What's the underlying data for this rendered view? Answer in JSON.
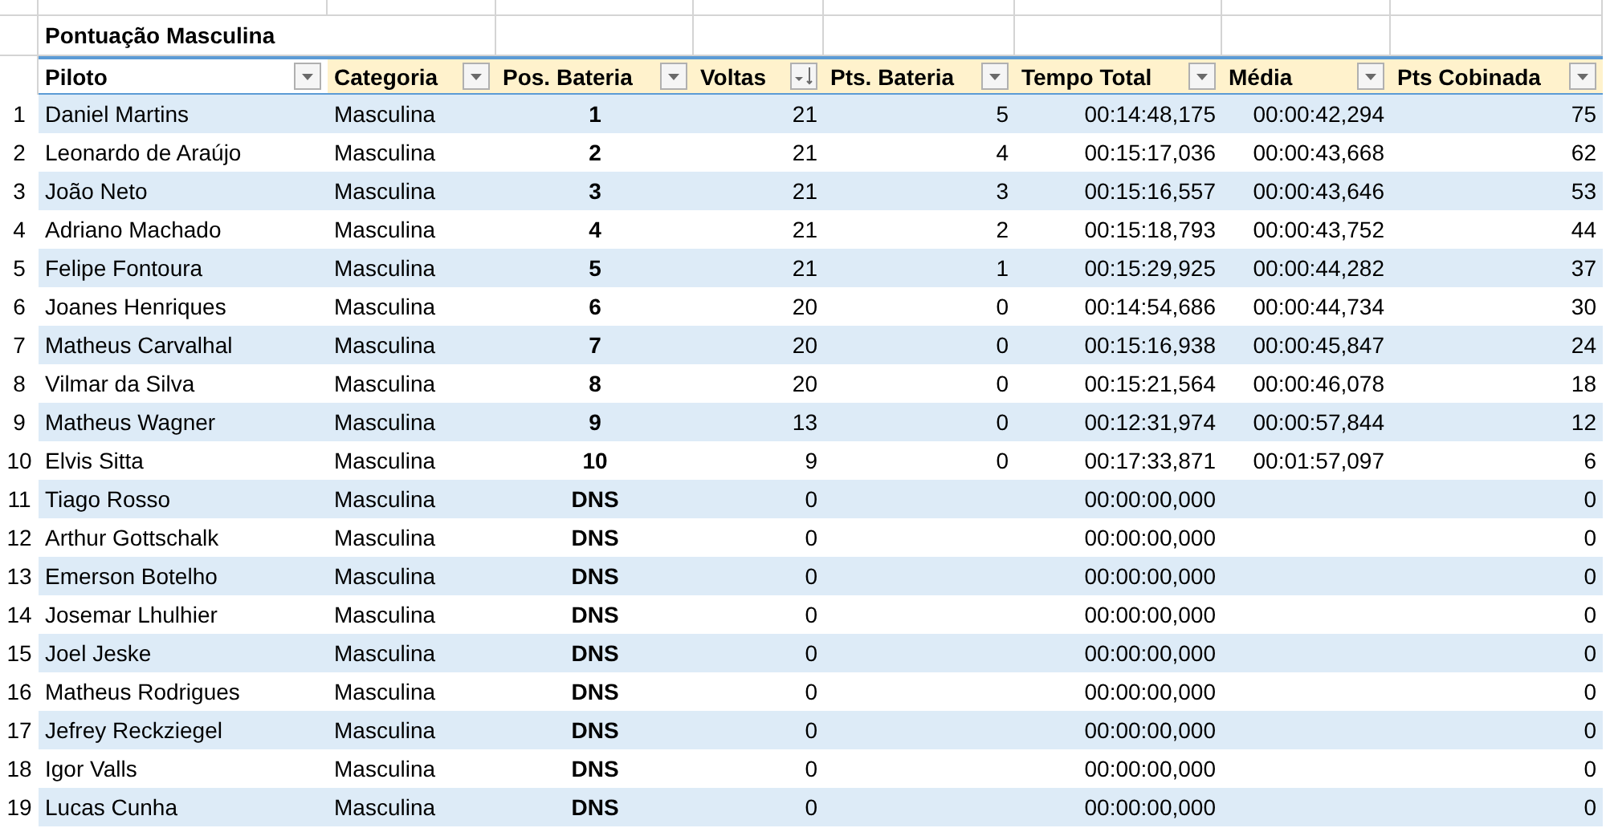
{
  "title": "Pontuação Masculina",
  "columns": [
    {
      "label": "Piloto",
      "highlighted": false,
      "kind": "filter"
    },
    {
      "label": "Categoria",
      "highlighted": true,
      "kind": "filter"
    },
    {
      "label": "Pos. Bateria",
      "highlighted": true,
      "kind": "filter"
    },
    {
      "label": "Voltas",
      "highlighted": true,
      "kind": "sort_desc"
    },
    {
      "label": "Pts. Bateria",
      "highlighted": true,
      "kind": "filter"
    },
    {
      "label": "Tempo Total",
      "highlighted": true,
      "kind": "filter"
    },
    {
      "label": "Média",
      "highlighted": true,
      "kind": "filter"
    },
    {
      "label": "Pts Cobinada",
      "highlighted": true,
      "kind": "filter"
    }
  ],
  "rows": [
    {
      "number": "1",
      "cells": [
        "Daniel Martins",
        "Masculina",
        "1",
        "21",
        "5",
        "00:14:48,175",
        "00:00:42,294",
        "75"
      ]
    },
    {
      "number": "2",
      "cells": [
        "Leonardo de Araújo",
        "Masculina",
        "2",
        "21",
        "4",
        "00:15:17,036",
        "00:00:43,668",
        "62"
      ]
    },
    {
      "number": "3",
      "cells": [
        "João Neto",
        "Masculina",
        "3",
        "21",
        "3",
        "00:15:16,557",
        "00:00:43,646",
        "53"
      ]
    },
    {
      "number": "4",
      "cells": [
        "Adriano Machado",
        "Masculina",
        "4",
        "21",
        "2",
        "00:15:18,793",
        "00:00:43,752",
        "44"
      ]
    },
    {
      "number": "5",
      "cells": [
        "Felipe Fontoura",
        "Masculina",
        "5",
        "21",
        "1",
        "00:15:29,925",
        "00:00:44,282",
        "37"
      ]
    },
    {
      "number": "6",
      "cells": [
        "Joanes Henriques",
        "Masculina",
        "6",
        "20",
        "0",
        "00:14:54,686",
        "00:00:44,734",
        "30"
      ]
    },
    {
      "number": "7",
      "cells": [
        "Matheus Carvalhal",
        "Masculina",
        "7",
        "20",
        "0",
        "00:15:16,938",
        "00:00:45,847",
        "24"
      ]
    },
    {
      "number": "8",
      "cells": [
        "Vilmar da Silva",
        "Masculina",
        "8",
        "20",
        "0",
        "00:15:21,564",
        "00:00:46,078",
        "18"
      ]
    },
    {
      "number": "9",
      "cells": [
        "Matheus Wagner",
        "Masculina",
        "9",
        "13",
        "0",
        "00:12:31,974",
        "00:00:57,844",
        "12"
      ]
    },
    {
      "number": "10",
      "cells": [
        "Elvis Sitta",
        "Masculina",
        "10",
        "9",
        "0",
        "00:17:33,871",
        "00:01:57,097",
        "6"
      ]
    },
    {
      "number": "11",
      "cells": [
        "Tiago Rosso",
        "Masculina",
        "DNS",
        "0",
        null,
        "00:00:00,000",
        null,
        "0"
      ]
    },
    {
      "number": "12",
      "cells": [
        "Arthur Gottschalk",
        "Masculina",
        "DNS",
        "0",
        null,
        "00:00:00,000",
        null,
        "0"
      ]
    },
    {
      "number": "13",
      "cells": [
        "Emerson Botelho",
        "Masculina",
        "DNS",
        "0",
        null,
        "00:00:00,000",
        null,
        "0"
      ]
    },
    {
      "number": "14",
      "cells": [
        "Josemar Lhulhier",
        "Masculina",
        "DNS",
        "0",
        null,
        "00:00:00,000",
        null,
        "0"
      ]
    },
    {
      "number": "15",
      "cells": [
        "Joel Jeske",
        "Masculina",
        "DNS",
        "0",
        null,
        "00:00:00,000",
        null,
        "0"
      ]
    },
    {
      "number": "16",
      "cells": [
        "Matheus Rodrigues",
        "Masculina",
        "DNS",
        "0",
        null,
        "00:00:00,000",
        null,
        "0"
      ]
    },
    {
      "number": "17",
      "cells": [
        "Jefrey Reckziegel",
        "Masculina",
        "DNS",
        "0",
        null,
        "00:00:00,000",
        null,
        "0"
      ]
    },
    {
      "number": "18",
      "cells": [
        "Igor Valls",
        "Masculina",
        "DNS",
        "0",
        null,
        "00:00:00,000",
        null,
        "0"
      ]
    },
    {
      "number": "19",
      "cells": [
        "Lucas Cunha",
        "Masculina",
        "DNS",
        "0",
        null,
        "00:00:00,000",
        null,
        "0"
      ]
    }
  ]
}
